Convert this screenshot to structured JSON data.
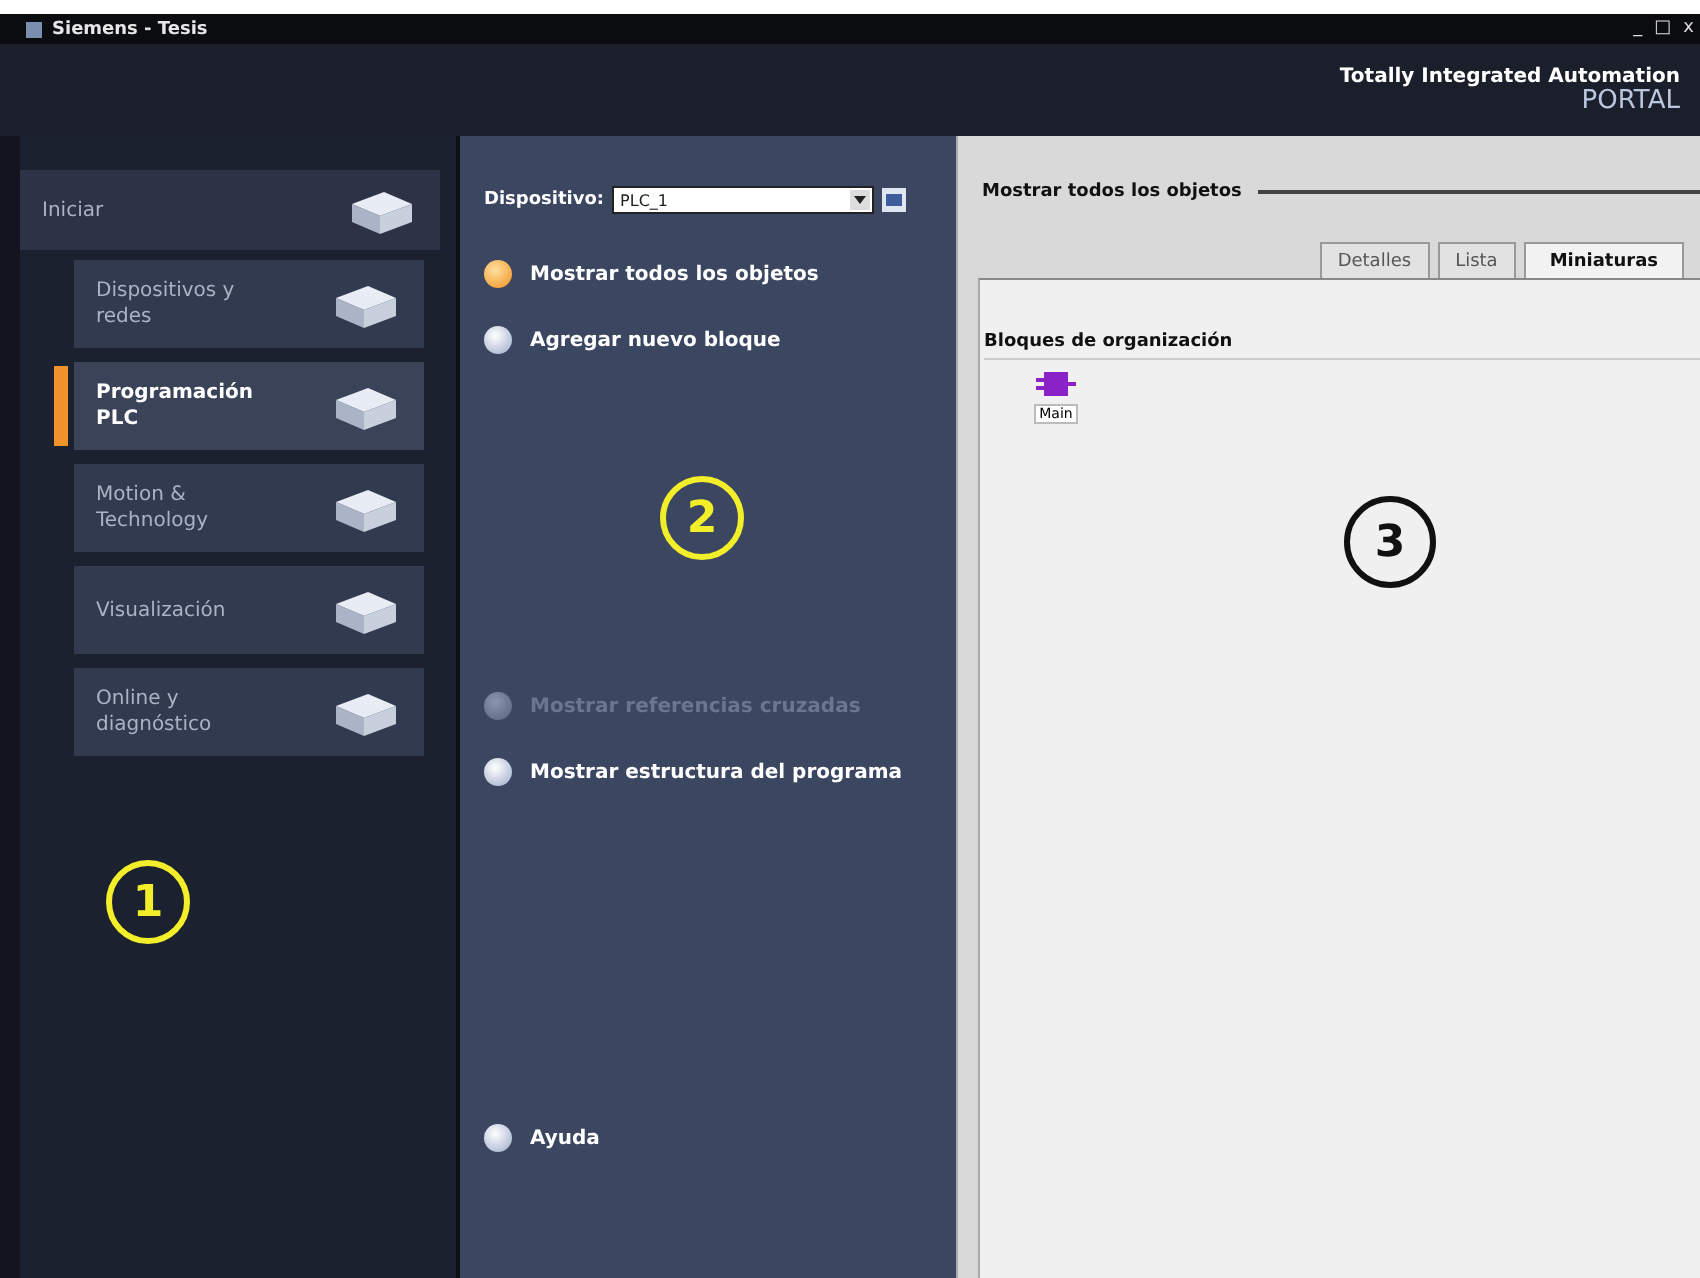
{
  "window": {
    "title": "Siemens - Tesis",
    "controls": [
      "_",
      "□",
      "x"
    ]
  },
  "header": {
    "brand": "Totally Integrated Automation",
    "product": "PORTAL"
  },
  "portals": [
    {
      "label": "Iniciar",
      "kind": "main",
      "selected": false
    },
    {
      "label": "Dispositivos y redes",
      "kind": "sub",
      "selected": false
    },
    {
      "label": "Programación PLC",
      "kind": "sub",
      "selected": true
    },
    {
      "label": "Motion & Technology",
      "kind": "sub",
      "selected": false
    },
    {
      "label": "Visualización",
      "kind": "sub",
      "selected": false
    },
    {
      "label": "Online y diagnóstico",
      "kind": "sub",
      "selected": false
    }
  ],
  "device": {
    "label": "Dispositivo:",
    "value": "PLC_1"
  },
  "actions": [
    {
      "label": "Mostrar todos los objetos",
      "selected": true,
      "disabled": false
    },
    {
      "label": "Agregar nuevo bloque",
      "selected": false,
      "disabled": false
    },
    {
      "label": "Mostrar referencias cruzadas",
      "selected": false,
      "disabled": true
    },
    {
      "label": "Mostrar estructura del programa",
      "selected": false,
      "disabled": false
    },
    {
      "label": "Ayuda",
      "selected": false,
      "disabled": false
    }
  ],
  "content": {
    "title": "Mostrar todos los objetos",
    "tabs": [
      {
        "label": "Detalles",
        "selected": false
      },
      {
        "label": "Lista",
        "selected": false
      },
      {
        "label": "Miniaturas",
        "selected": true
      }
    ],
    "group": "Bloques de organización",
    "blocks": [
      {
        "label": "Main"
      }
    ]
  },
  "annotations": [
    "1",
    "2",
    "3"
  ]
}
